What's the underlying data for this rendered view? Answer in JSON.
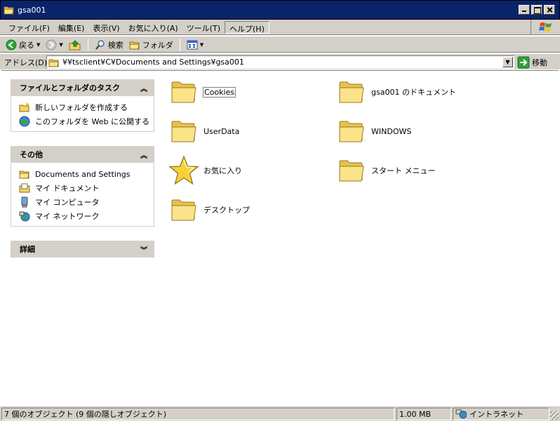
{
  "window": {
    "title": "gsa001",
    "icon": "folder-icon"
  },
  "menubar": {
    "items": [
      "ファイル(F)",
      "編集(E)",
      "表示(V)",
      "お気に入り(A)",
      "ツール(T)",
      "ヘルプ(H)"
    ],
    "active_item": "ヘルプ(H)"
  },
  "toolbar": {
    "back_label": "戻る",
    "search_label": "検索",
    "folders_label": "フォルダ"
  },
  "addressbar": {
    "label": "アドレス(D)",
    "path": "¥¥tsclient¥C¥Documents and Settings¥gsa001",
    "go_label": "移動"
  },
  "tasks_panel": {
    "title": "ファイルとフォルダのタスク",
    "links": [
      "新しいフォルダを作成する",
      "このフォルダを Web に公開する"
    ]
  },
  "other_panel": {
    "title": "その他",
    "links": [
      "Documents and Settings",
      "マイ ドキュメント",
      "マイ コンピュータ",
      "マイ ネットワーク"
    ]
  },
  "details_panel": {
    "title": "詳細"
  },
  "files": [
    {
      "name": "Cookies",
      "icon": "folder-icon"
    },
    {
      "name": "gsa001 のドキュメント",
      "icon": "folder-icon"
    },
    {
      "name": "UserData",
      "icon": "folder-icon"
    },
    {
      "name": "WINDOWS",
      "icon": "folder-icon"
    },
    {
      "name": "お気に入り",
      "icon": "star-icon"
    },
    {
      "name": "スタート メニュー",
      "icon": "folder-icon"
    },
    {
      "name": "デスクトップ",
      "icon": "folder-icon"
    }
  ],
  "statusbar": {
    "objects": "7 個のオブジェクト (9 個の隠しオブジェクト)",
    "size": "1.00 MB",
    "zone": "イントラネット"
  },
  "colors": {
    "titlebar": "#0a246a",
    "chrome": "#d4d0c8",
    "folder": "#f5d45e"
  }
}
